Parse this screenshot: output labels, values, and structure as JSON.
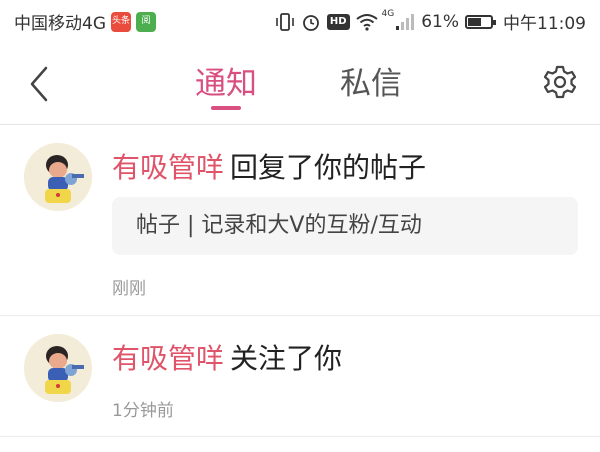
{
  "status_bar": {
    "carrier": "中国移动4G",
    "app_icon_1": "头条",
    "app_icon_2": "阅",
    "battery_percent": "61%",
    "battery_level": 0.61,
    "time": "中午11:09",
    "hd_label": "HD",
    "network_label": "4G",
    "icons": [
      "vibrate-icon",
      "alarm-icon",
      "hd-icon",
      "wifi-icon",
      "signal-icon",
      "battery-icon"
    ]
  },
  "nav": {
    "tabs": [
      {
        "label": "通知",
        "active": true
      },
      {
        "label": "私信",
        "active": false
      }
    ],
    "accent_color": "#d94f80",
    "icons": [
      "back-icon",
      "settings-icon"
    ]
  },
  "notifications": [
    {
      "sender": "有吸管咩",
      "action": "回复了你的帖子",
      "post_title": "帖子 | 记录和大V的互粉/互动",
      "time": "刚刚"
    },
    {
      "sender": "有吸管咩",
      "action": "关注了你",
      "time": "1分钟前"
    }
  ],
  "colors": {
    "sender_name": "#e0546a",
    "time_text": "#999999",
    "card_bg": "#f5f5f5"
  }
}
